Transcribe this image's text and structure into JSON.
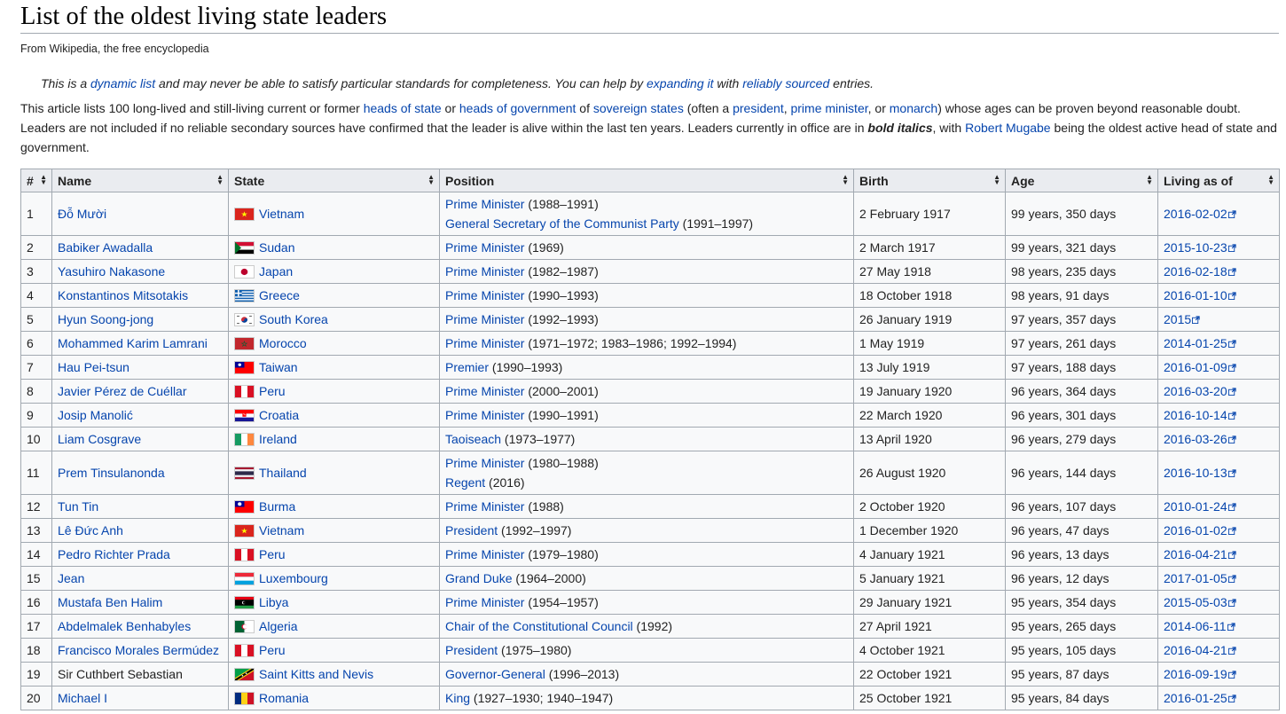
{
  "title": "List of the oldest living state leaders",
  "tagline": "From Wikipedia, the free encyclopedia",
  "hatnote": {
    "t1": "This is a ",
    "l1": "dynamic list",
    "t2": " and may never be able to satisfy particular standards for completeness. You can help by ",
    "l2": "expanding it",
    "t3": " with ",
    "l3": "reliably sourced",
    "t4": " entries."
  },
  "intro": {
    "t1": "This article lists 100 long-lived and still-living current or former ",
    "l1": "heads of state",
    "t2": " or ",
    "l2": "heads of government",
    "t3": " of ",
    "l3": "sovereign states",
    "t4": " (often a ",
    "l4": "president",
    "t5": ", ",
    "l5": "prime minister",
    "t6": ", or ",
    "l6": "monarch",
    "t7": ") whose ages can be proven beyond reasonable doubt. Leaders are not included if no reliable secondary sources have confirmed that the leader is alive within the last ten years. Leaders currently in office are in ",
    "bold": "bold italics",
    "t8": ", with ",
    "l7": "Robert Mugabe",
    "t9": " being the oldest active head of state and government."
  },
  "table": {
    "headers": [
      "#",
      "Name",
      "State",
      "Position",
      "Birth",
      "Age",
      "Living as of"
    ],
    "rows": [
      {
        "n": "1",
        "name": "Đỗ Mười",
        "state": "Vietnam",
        "flag": "vn",
        "pos": [
          {
            "l": "Prime Minister",
            "t": " (1988–1991)"
          },
          {
            "l": "General Secretary of the Communist Party",
            "t": " (1991–1997)"
          }
        ],
        "birth": "2 February 1917",
        "age": "99 years, 350 days",
        "asof": "2016-02-02"
      },
      {
        "n": "2",
        "name": "Babiker Awadalla",
        "state": "Sudan",
        "flag": "sd",
        "pos": [
          {
            "l": "Prime Minister",
            "t": " (1969)"
          }
        ],
        "birth": "2 March 1917",
        "age": "99 years, 321 days",
        "asof": "2015-10-23"
      },
      {
        "n": "3",
        "name": "Yasuhiro Nakasone",
        "state": "Japan",
        "flag": "jp",
        "pos": [
          {
            "l": "Prime Minister",
            "t": " (1982–1987)"
          }
        ],
        "birth": "27 May 1918",
        "age": "98 years, 235 days",
        "asof": "2016-02-18"
      },
      {
        "n": "4",
        "name": "Konstantinos Mitsotakis",
        "state": "Greece",
        "flag": "gr",
        "pos": [
          {
            "l": "Prime Minister",
            "t": " (1990–1993)"
          }
        ],
        "birth": "18 October 1918",
        "age": "98 years, 91 days",
        "asof": "2016-01-10"
      },
      {
        "n": "5",
        "name": "Hyun Soong-jong",
        "state": "South Korea",
        "flag": "kr",
        "pos": [
          {
            "l": "Prime Minister",
            "t": " (1992–1993)"
          }
        ],
        "birth": "26 January 1919",
        "age": "97 years, 357 days",
        "asof": "2015"
      },
      {
        "n": "6",
        "name": "Mohammed Karim Lamrani",
        "state": "Morocco",
        "flag": "ma",
        "pos": [
          {
            "l": "Prime Minister",
            "t": " (1971–1972; 1983–1986; 1992–1994)"
          }
        ],
        "birth": "1 May 1919",
        "age": "97 years, 261 days",
        "asof": "2014-01-25"
      },
      {
        "n": "7",
        "name": "Hau Pei-tsun",
        "state": "Taiwan",
        "flag": "tw",
        "pos": [
          {
            "l": "Premier",
            "t": " (1990–1993)"
          }
        ],
        "birth": "13 July 1919",
        "age": "97 years, 188 days",
        "asof": "2016-01-09"
      },
      {
        "n": "8",
        "name": "Javier Pérez de Cuéllar",
        "state": "Peru",
        "flag": "pe",
        "pos": [
          {
            "l": "Prime Minister",
            "t": " (2000–2001)"
          }
        ],
        "birth": "19 January 1920",
        "age": "96 years, 364 days",
        "asof": "2016-03-20"
      },
      {
        "n": "9",
        "name": "Josip Manolić",
        "state": "Croatia",
        "flag": "hr",
        "pos": [
          {
            "l": "Prime Minister",
            "t": " (1990–1991)"
          }
        ],
        "birth": "22 March 1920",
        "age": "96 years, 301 days",
        "asof": "2016-10-14"
      },
      {
        "n": "10",
        "name": "Liam Cosgrave",
        "state": "Ireland",
        "flag": "ie",
        "pos": [
          {
            "l": "Taoiseach",
            "t": " (1973–1977)"
          }
        ],
        "birth": "13 April 1920",
        "age": "96 years, 279 days",
        "asof": "2016-03-26"
      },
      {
        "n": "11",
        "name": "Prem Tinsulanonda",
        "state": "Thailand",
        "flag": "th",
        "pos": [
          {
            "l": "Prime Minister",
            "t": " (1980–1988)"
          },
          {
            "l": "Regent",
            "t": " (2016)"
          }
        ],
        "birth": "26 August 1920",
        "age": "96 years, 144 days",
        "asof": "2016-10-13"
      },
      {
        "n": "12",
        "name": "Tun Tin",
        "state": "Burma",
        "flag": "mm",
        "pos": [
          {
            "l": "Prime Minister",
            "t": " (1988)"
          }
        ],
        "birth": "2 October 1920",
        "age": "96 years, 107 days",
        "asof": "2010-01-24"
      },
      {
        "n": "13",
        "name": "Lê Đức Anh",
        "state": "Vietnam",
        "flag": "vn",
        "pos": [
          {
            "l": "President",
            "t": " (1992–1997)"
          }
        ],
        "birth": "1 December 1920",
        "age": "96 years, 47 days",
        "asof": "2016-01-02"
      },
      {
        "n": "14",
        "name": "Pedro Richter Prada",
        "state": "Peru",
        "flag": "pe",
        "pos": [
          {
            "l": "Prime Minister",
            "t": " (1979–1980)"
          }
        ],
        "birth": "4 January 1921",
        "age": "96 years, 13 days",
        "asof": "2016-04-21"
      },
      {
        "n": "15",
        "name": "Jean",
        "state": "Luxembourg",
        "flag": "lu",
        "pos": [
          {
            "l": "Grand Duke",
            "t": " (1964–2000)"
          }
        ],
        "birth": "5 January 1921",
        "age": "96 years, 12 days",
        "asof": "2017-01-05"
      },
      {
        "n": "16",
        "name": "Mustafa Ben Halim",
        "state": "Libya",
        "flag": "ly",
        "pos": [
          {
            "l": "Prime Minister",
            "t": " (1954–1957)"
          }
        ],
        "birth": "29 January 1921",
        "age": "95 years, 354 days",
        "asof": "2015-05-03"
      },
      {
        "n": "17",
        "name": "Abdelmalek Benhabyles",
        "state": "Algeria",
        "flag": "dz",
        "pos": [
          {
            "l": "Chair of the Constitutional Council",
            "t": " (1992)"
          }
        ],
        "birth": "27 April 1921",
        "age": "95 years, 265 days",
        "asof": "2014-06-11"
      },
      {
        "n": "18",
        "name": "Francisco Morales Bermúdez",
        "state": "Peru",
        "flag": "pe",
        "pos": [
          {
            "l": "President",
            "t": " (1975–1980)"
          }
        ],
        "birth": "4 October 1921",
        "age": "95 years, 105 days",
        "asof": "2016-04-21"
      },
      {
        "n": "19",
        "name": "Sir Cuthbert Sebastian",
        "nameLink": false,
        "state": "Saint Kitts and Nevis",
        "flag": "kn",
        "pos": [
          {
            "l": "Governor-General",
            "t": " (1996–2013)"
          }
        ],
        "birth": "22 October 1921",
        "age": "95 years, 87 days",
        "asof": "2016-09-19"
      },
      {
        "n": "20",
        "name": "Michael I",
        "state": "Romania",
        "flag": "ro",
        "pos": [
          {
            "l": "King",
            "t": " (1927–1930; 1940–1947)"
          }
        ],
        "birth": "25 October 1921",
        "age": "95 years, 84 days",
        "asof": "2016-01-25"
      }
    ]
  }
}
